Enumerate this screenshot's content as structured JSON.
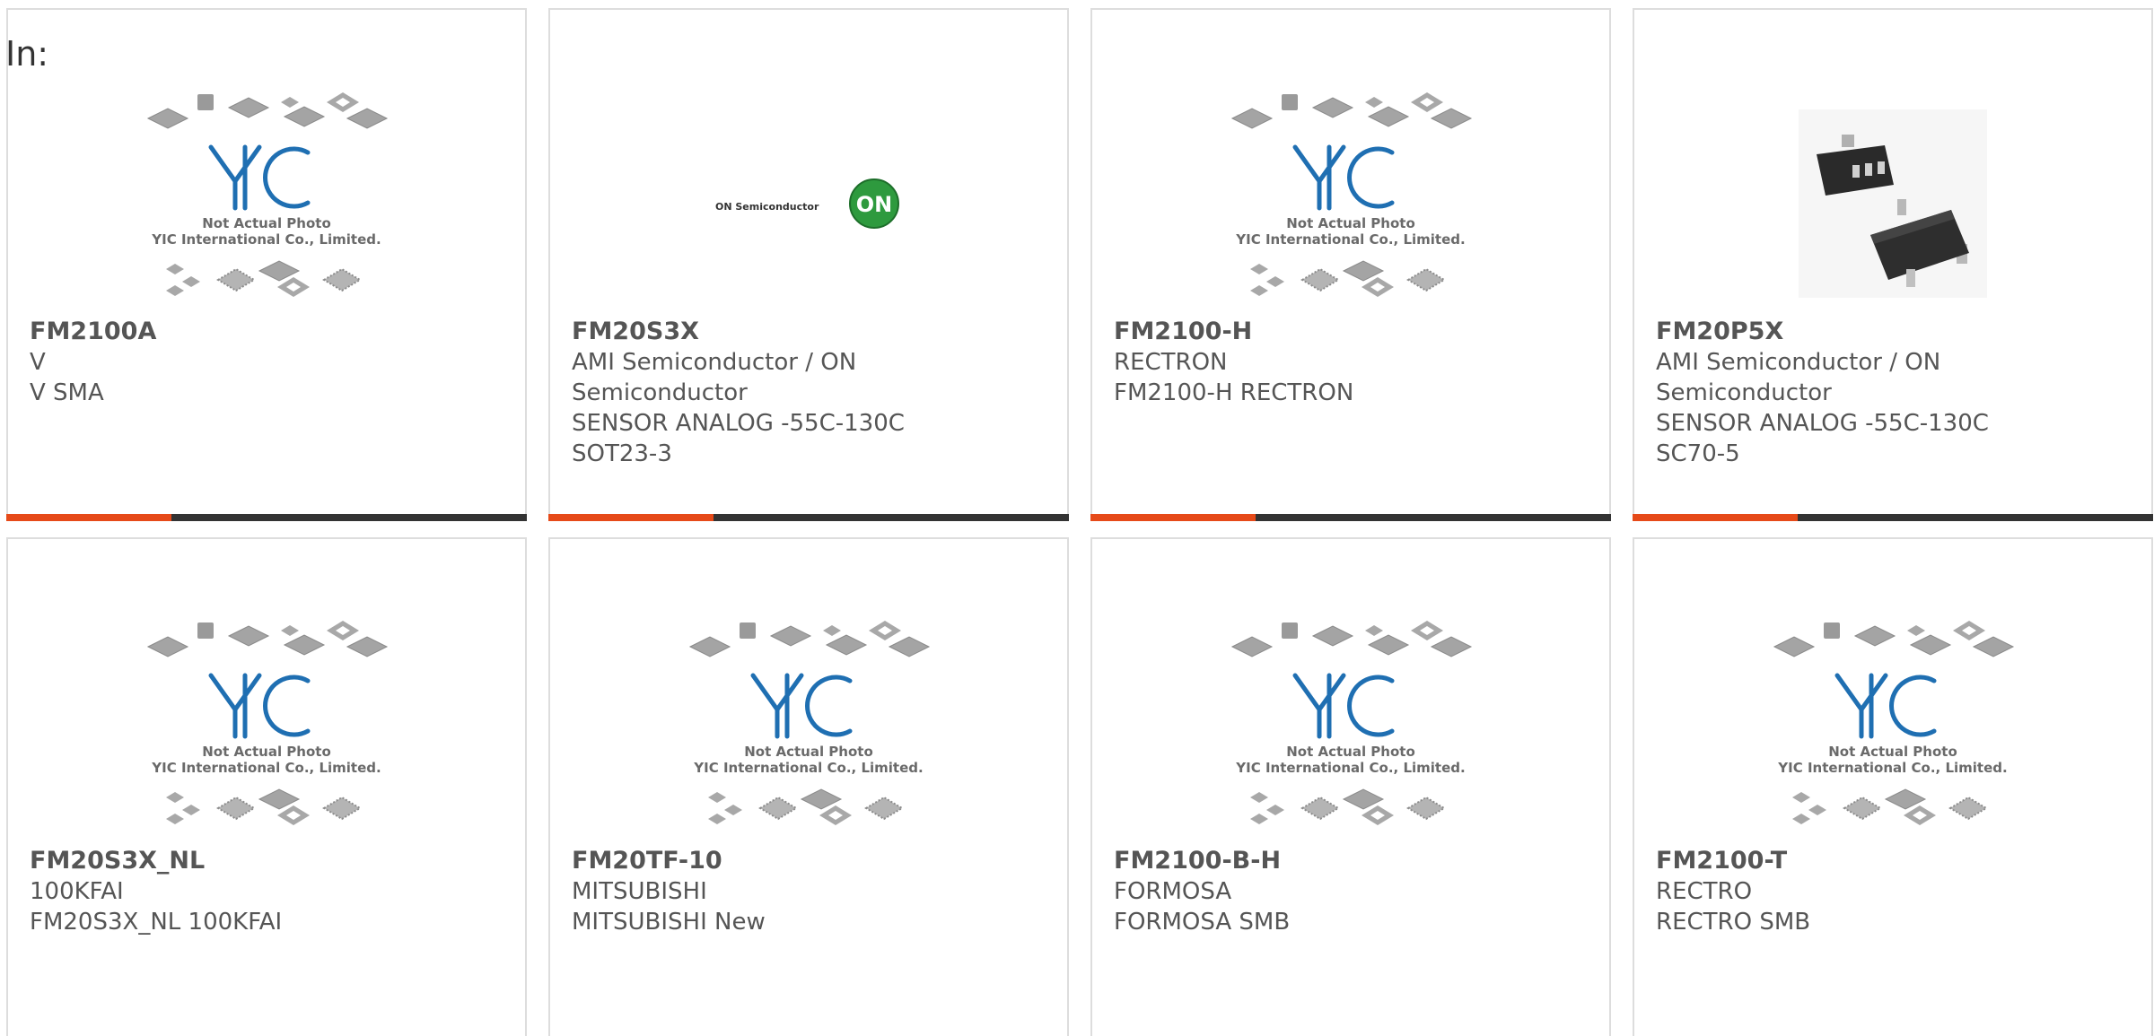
{
  "header": {
    "label": "In:"
  },
  "colors": {
    "accent": "#e64a19",
    "bar_dark": "#333333",
    "logo_blue": "#1f6fb2",
    "on_green": "#2e9a3e"
  },
  "placeholder": {
    "line1": "Not Actual Photo",
    "line2": "YIC International Co., Limited.",
    "logo": "YIC"
  },
  "on_logo": {
    "text": "ON Semiconductor",
    "badge": "ON"
  },
  "products": [
    {
      "name": "FM2100A",
      "lines": [
        "V",
        "V SMA"
      ],
      "photo": "yic-placeholder"
    },
    {
      "name": "FM20S3X",
      "lines": [
        "AMI Semiconductor / ON",
        "Semiconductor",
        "SENSOR ANALOG -55C-130C",
        "SOT23-3"
      ],
      "photo": "on-semiconductor-logo"
    },
    {
      "name": "FM2100-H",
      "lines": [
        "RECTRON",
        "FM2100-H RECTRON"
      ],
      "photo": "yic-placeholder"
    },
    {
      "name": "FM20P5X",
      "lines": [
        "AMI Semiconductor / ON",
        "Semiconductor",
        "SENSOR ANALOG -55C-130C",
        "SC70-5"
      ],
      "photo": "sc70-chip-photo"
    },
    {
      "name": "FM20S3X_NL",
      "lines": [
        "100KFAI",
        "FM20S3X_NL 100KFAI"
      ],
      "photo": "yic-placeholder"
    },
    {
      "name": "FM20TF-10",
      "lines": [
        "MITSUBISHI",
        "MITSUBISHI New"
      ],
      "photo": "yic-placeholder"
    },
    {
      "name": "FM2100-B-H",
      "lines": [
        "FORMOSA",
        "FORMOSA SMB"
      ],
      "photo": "yic-placeholder"
    },
    {
      "name": "FM2100-T",
      "lines": [
        "RECTRO",
        "RECTRO SMB"
      ],
      "photo": "yic-placeholder"
    }
  ]
}
